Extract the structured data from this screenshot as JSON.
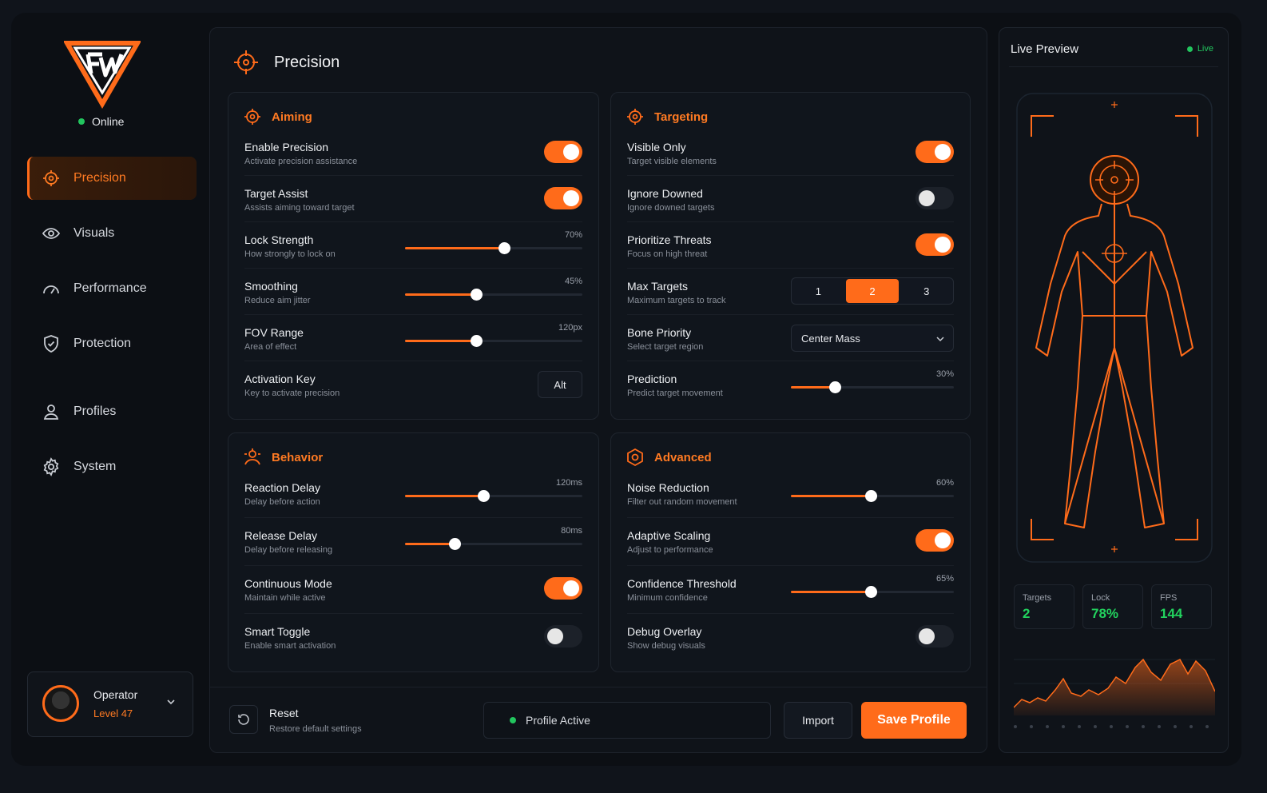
{
  "app": {
    "status": "Online",
    "colors": {
      "accent": "#ff6b1a",
      "online": "#22c55e",
      "panel": "#0f1319"
    }
  },
  "sidebar": {
    "items": [
      {
        "label": "Precision",
        "icon": "crosshair-icon",
        "active": true
      },
      {
        "label": "Visuals",
        "icon": "eye-icon"
      },
      {
        "label": "Performance",
        "icon": "gauge-icon"
      },
      {
        "label": "Protection",
        "icon": "shield-icon"
      },
      {
        "label": "Profiles",
        "icon": "user-icon"
      },
      {
        "label": "System",
        "icon": "gear-icon"
      }
    ],
    "operator": {
      "name": "Operator",
      "level": "Level 47"
    }
  },
  "main": {
    "title": "Precision",
    "aiming": {
      "title": "Aiming",
      "rows": [
        {
          "title": "Enable Precision",
          "sub": "Activate precision assistance",
          "toggle": true
        },
        {
          "title": "Target Assist",
          "sub": "Assists aiming toward target",
          "toggle": true
        },
        {
          "title": "Lock Strength",
          "sub": "How strongly to lock on",
          "value": "70%",
          "level": 0.56
        },
        {
          "title": "Smoothing",
          "sub": "Reduce aim jitter",
          "value": "45%",
          "level": 0.4
        },
        {
          "title": "FOV Range",
          "sub": "Area of effect",
          "value": "120px",
          "level": 0.4
        },
        {
          "title": "Activation Key",
          "sub": "Key to activate precision",
          "key": "Alt"
        }
      ]
    },
    "targeting": {
      "title": "Targeting",
      "rows": [
        {
          "title": "Visible Only",
          "sub": "Target visible elements",
          "toggle": true
        },
        {
          "title": "Ignore Downed",
          "sub": "Ignore downed targets",
          "toggle": false
        },
        {
          "title": "Prioritize Threats",
          "sub": "Focus on high threat",
          "toggle": true
        },
        {
          "title": "Max Targets",
          "sub": "Maximum targets to track",
          "options": [
            "1",
            "2",
            "3"
          ],
          "selected": "2"
        },
        {
          "title": "Bone Priority",
          "sub": "Select target region",
          "select": "Center Mass"
        },
        {
          "title": "Prediction",
          "sub": "Predict target movement",
          "value": "30%",
          "level": 0.27
        }
      ]
    },
    "behavior": {
      "title": "Behavior",
      "rows": [
        {
          "title": "Reaction Delay",
          "sub": "Delay before action",
          "value": "120ms",
          "level": 0.44
        },
        {
          "title": "Release Delay",
          "sub": "Delay before releasing",
          "value": "80ms",
          "level": 0.28
        },
        {
          "title": "Continuous Mode",
          "sub": "Maintain while active",
          "toggle": true
        },
        {
          "title": "Smart Toggle",
          "sub": "Enable smart activation",
          "toggle": false
        }
      ]
    },
    "advanced": {
      "title": "Advanced",
      "rows": [
        {
          "title": "Noise Reduction",
          "sub": "Filter out random movement",
          "value": "60%",
          "level": 0.49
        },
        {
          "title": "Adaptive Scaling",
          "sub": "Adjust to performance",
          "toggle": true
        },
        {
          "title": "Confidence Threshold",
          "sub": "Minimum confidence",
          "value": "65%",
          "level": 0.49
        },
        {
          "title": "Debug Overlay",
          "sub": "Show debug visuals",
          "toggle": false
        }
      ]
    },
    "footer": {
      "reset_title": "Reset",
      "reset_sub": "Restore default settings",
      "profile_status": "Profile Active",
      "import_label": "Import",
      "save_label": "Save Profile"
    }
  },
  "preview": {
    "title": "Live Preview",
    "live": "Live",
    "stats": [
      {
        "label": "Targets",
        "value": "2"
      },
      {
        "label": "Lock",
        "value": "78%"
      },
      {
        "label": "FPS",
        "value": "144"
      }
    ]
  }
}
